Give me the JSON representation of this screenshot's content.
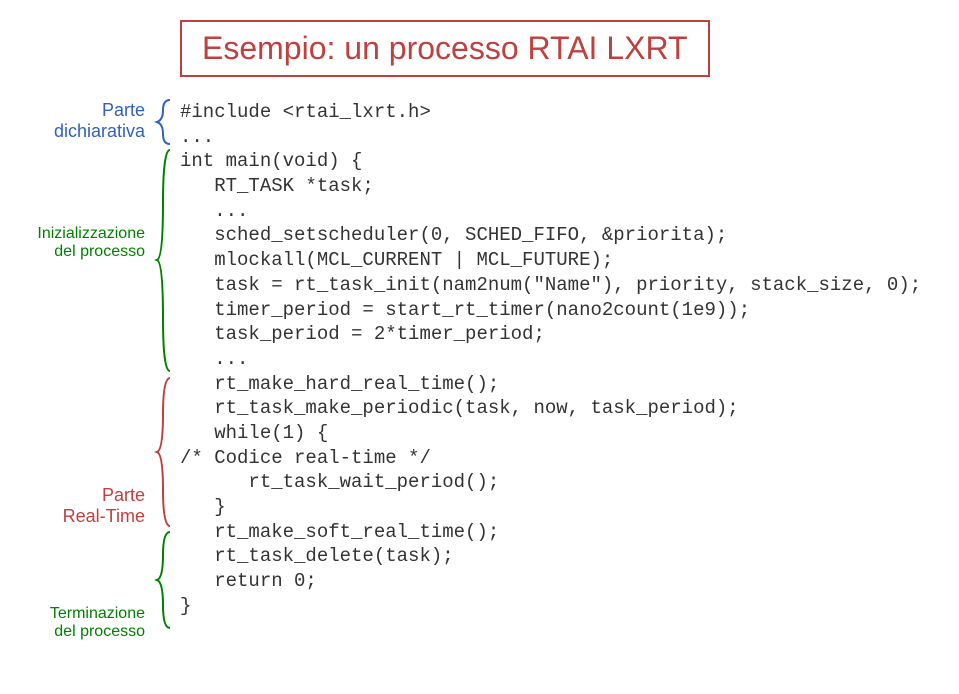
{
  "title": "Esempio: un processo RTAI LXRT",
  "labels": {
    "dichiarativa_l1": "Parte",
    "dichiarativa_l2": "dichiarativa",
    "inizializzazione_l1": "Inizializzazione",
    "inizializzazione_l2": "del processo",
    "realtime_l1": "Parte",
    "realtime_l2": "Real-Time",
    "terminazione_l1": "Terminazione",
    "terminazione_l2": "del processo"
  },
  "code": {
    "l01": "#include <rtai_lxrt.h>",
    "l02": "...",
    "l03": "int main(void) {",
    "l04": "   RT_TASK *task;",
    "l05": "   ...",
    "l06": "   sched_setscheduler(0, SCHED_FIFO, &priorita);",
    "l07": "   mlockall(MCL_CURRENT | MCL_FUTURE);",
    "l08": "   task = rt_task_init(nam2num(\"Name\"), priority, stack_size, 0);",
    "l09": "   timer_period = start_rt_timer(nano2count(1e9));",
    "l10": "   task_period = 2*timer_period;",
    "l11": "   ...",
    "l12": "   rt_make_hard_real_time();",
    "l13": "   rt_task_make_periodic(task, now, task_period);",
    "l14": "   while(1) {",
    "l15": "/* Codice real-time */",
    "l16": "      rt_task_wait_period();",
    "l17": "   }",
    "l18": "   rt_make_soft_real_time();",
    "l19": "   rt_task_delete(task);",
    "l20": "   return 0;",
    "l21": "}"
  }
}
